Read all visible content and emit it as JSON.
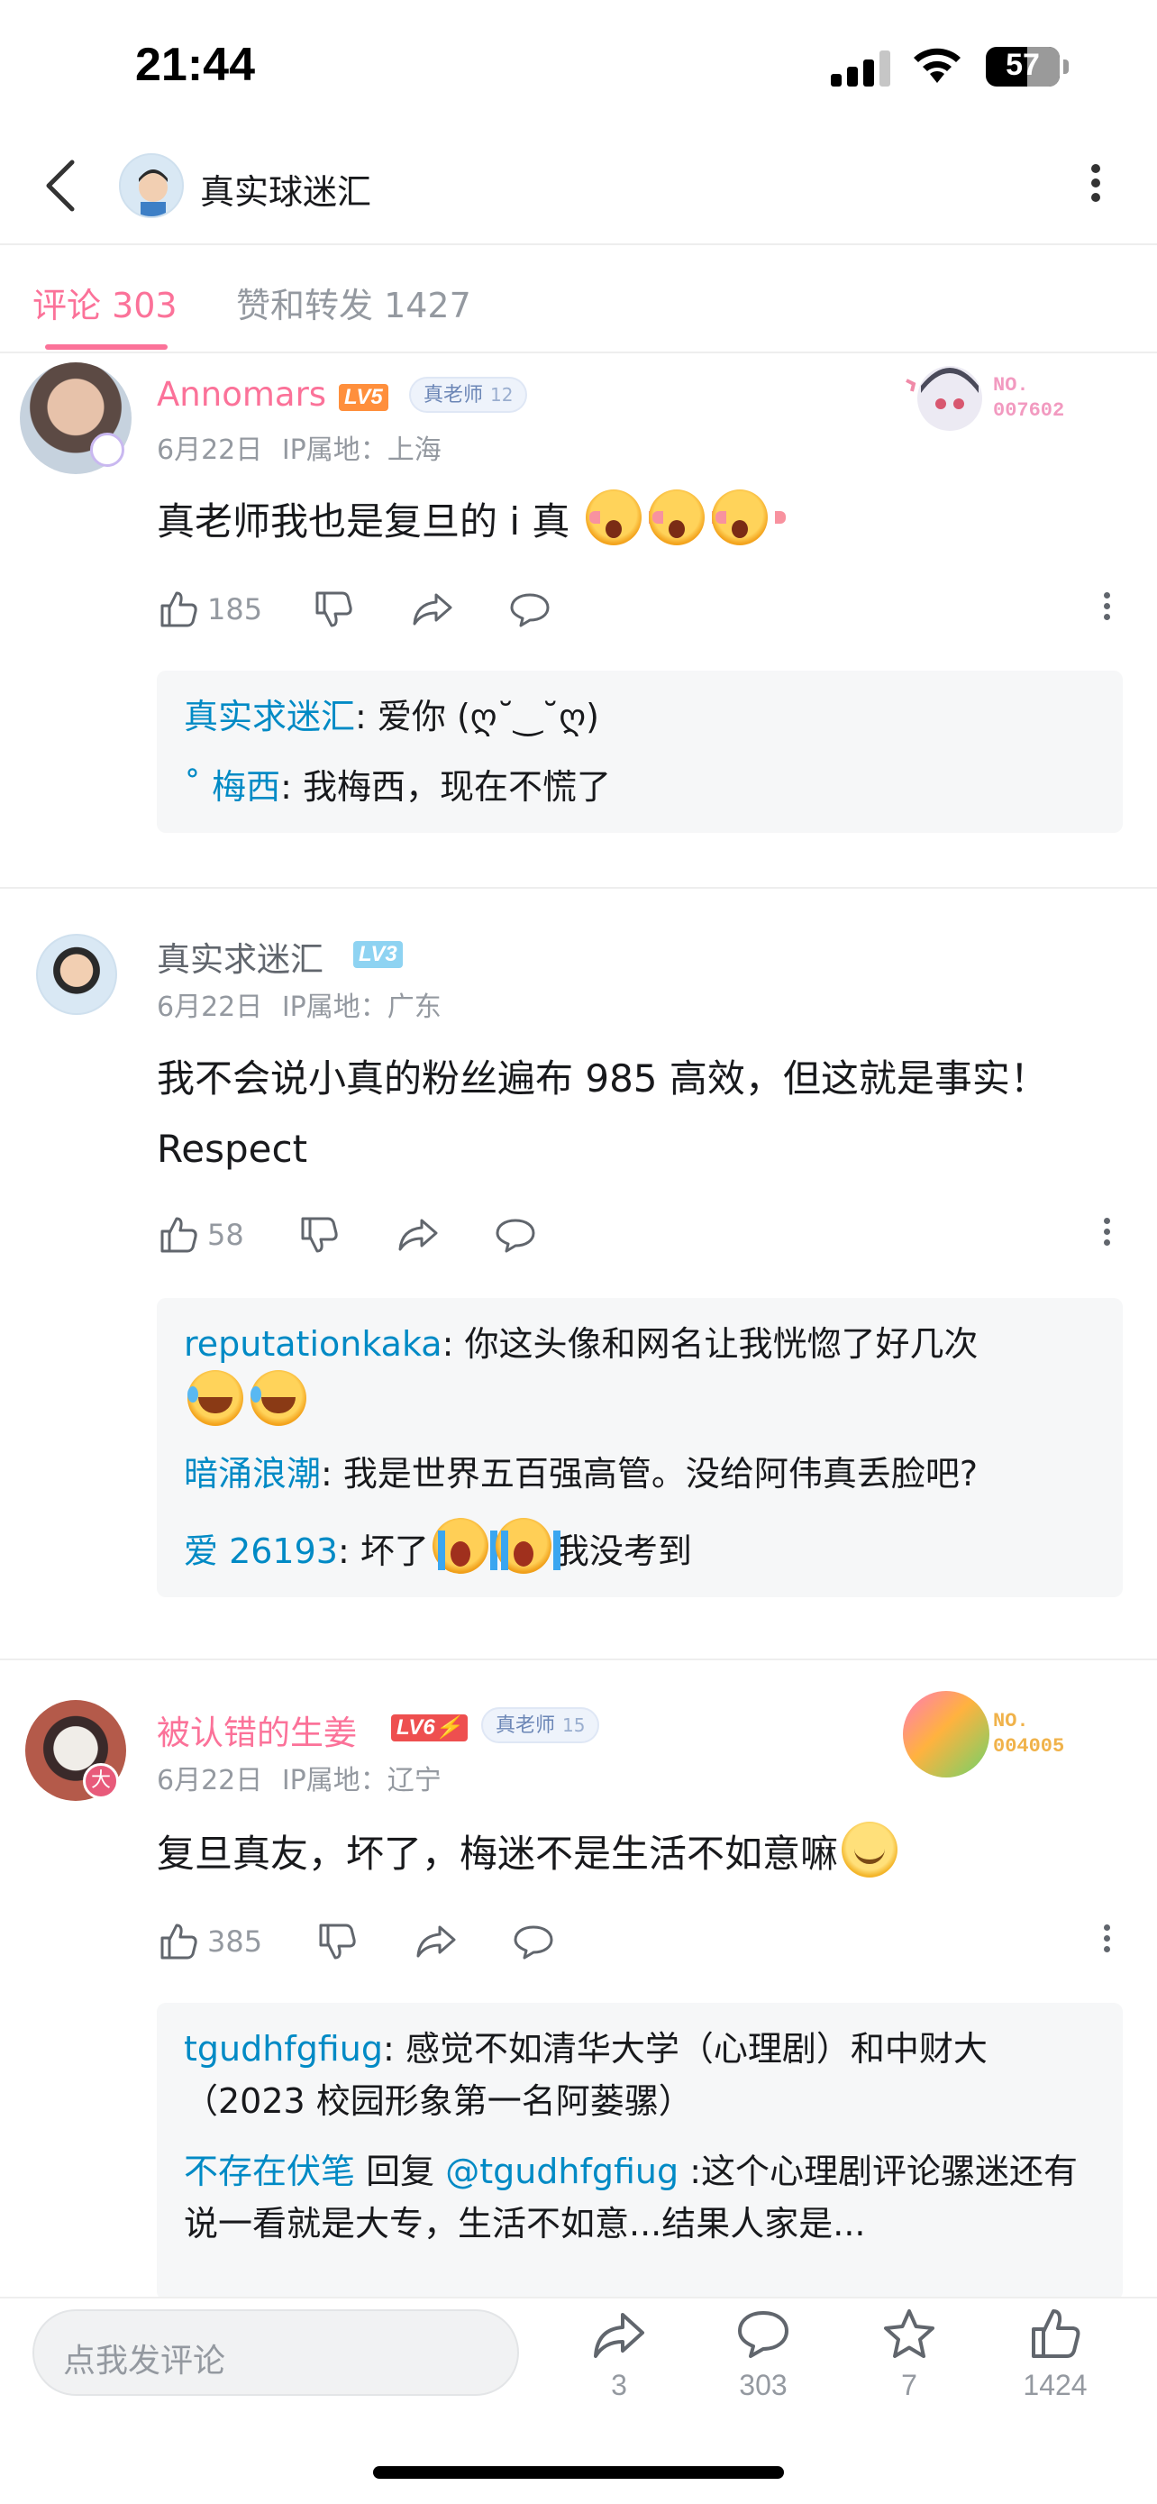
{
  "status_bar": {
    "time": "21:44",
    "battery": "57"
  },
  "header": {
    "title": "真实球迷汇"
  },
  "tabs": [
    {
      "label": "评论 303",
      "active": true
    },
    {
      "label": "赞和转发 1427",
      "active": false
    }
  ],
  "comments": [
    {
      "name": "Annomars",
      "name_color": "#fb7299",
      "level": "LV5",
      "badge_label": "真老师",
      "badge_level": "12",
      "fan_no": "NO.\n007602",
      "date": "6月22日",
      "ip": "IP属地：上海",
      "text": "真老师我也是复旦的 i 真",
      "likes": "185",
      "replies": [
        {
          "who": "真实求迷汇",
          "text": ": 爱你 (ღ˘‿˘ღ)"
        },
        {
          "who": "˚ 梅西",
          "text": ": 我梅西，现在不慌了"
        }
      ]
    },
    {
      "name": "真实求迷汇",
      "name_color": "#61666d",
      "level": "LV3",
      "date": "6月22日",
      "ip": "IP属地：广东",
      "text": "我不会说小真的粉丝遍布 985 高效，但这就是事实！Respect",
      "likes": "58",
      "replies": [
        {
          "who": "reputationkaka",
          "text": ": 你这头像和网名让我恍惚了好几次"
        },
        {
          "who": "暗涌浪潮",
          "text": ": 我是世界五百强高管。没给阿伟真丢脸吧?"
        },
        {
          "who": "爱 26193",
          "text": ": 坏了",
          "text2": "我没考到"
        }
      ]
    },
    {
      "name": "被认错的生姜",
      "name_color": "#fb7299",
      "level": "LV6⚡",
      "badge_label": "真老师",
      "badge_level": "15",
      "fan_no": "NO.\n004005",
      "date": "6月22日",
      "ip": "IP属地：辽宁",
      "text": "复旦真友，坏了，梅迷不是生活不如意嘛",
      "likes": "385",
      "replies": [
        {
          "who": "tgudhfgfiug",
          "text": ": 感觉不如清华大学（心理剧）和中财大（2023 校园形象第一名阿蒌骡）"
        },
        {
          "who": "不存在伏笔",
          "text": " 回复 ",
          "mention": "@tgudhfgfiug",
          "text2": " :这个心理剧评论骡迷还有说一看就是大专，生活不如意...结果人家是..."
        }
      ]
    }
  ],
  "bottom_bar": {
    "placeholder": "点我发评论",
    "share_count": "3",
    "comment_count": "303",
    "star_count": "7",
    "like_count": "1424"
  },
  "colors": {
    "accent": "#fb7299",
    "link": "#008ac5",
    "muted": "#9499a0"
  }
}
